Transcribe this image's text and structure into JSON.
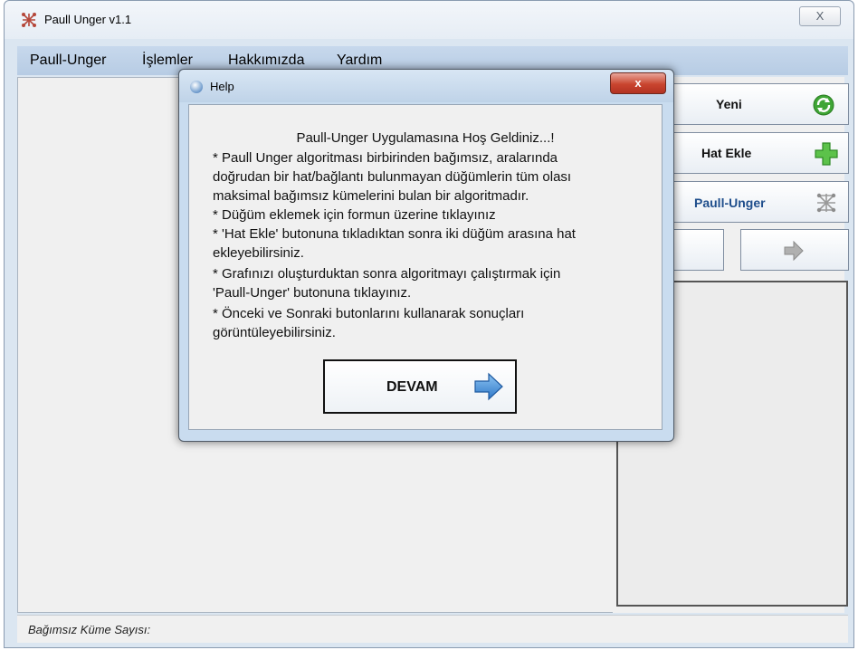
{
  "window": {
    "title": "Paull Unger v1.1",
    "close_glyph": "X",
    "app_icon": "graph-icon"
  },
  "menu": {
    "items": [
      "Paull-Unger",
      "İşlemler",
      "Hakkımızda",
      "Yardım"
    ]
  },
  "toolbar": {
    "new_label": "Yeni",
    "new_icon": "refresh-green-icon",
    "add_edge_label": "Hat Ekle",
    "add_edge_icon": "plus-green-icon",
    "run_label": "Paull-Unger",
    "run_icon": "graph-icon",
    "prev_icon": "arrow-left-gray-icon",
    "next_icon": "arrow-right-gray-icon"
  },
  "status": {
    "label": "Bağımsız Küme Sayısı:"
  },
  "dialog": {
    "title": "Help",
    "close_glyph": "x",
    "welcome": "Paull-Unger Uygulamasına Hoş Geldiniz...!",
    "lines": [
      "* Paull Unger algoritması birbirinden bağımsız, aralarında",
      "doğrudan bir hat/bağlantı bulunmayan düğümlerin tüm olası",
      "maksimal bağımsız kümelerini bulan bir algoritmadır.",
      "* Düğüm eklemek için formun üzerine tıklayınız",
      "* 'Hat Ekle' butonuna tıkladıktan sonra iki düğüm arasına hat",
      "ekleyebilirsiniz.",
      "* Grafınızı oluşturduktan sonra algoritmayı çalıştırmak için",
      "'Paull-Unger' butonuna tıklayınız.",
      "* Önceki ve Sonraki butonlarını kullanarak sonuçları",
      "görüntüleyebilirsiniz."
    ],
    "continue_label": "DEVAM",
    "continue_icon": "arrow-right-blue-icon"
  },
  "colors": {
    "menubar": "#bcd0e7",
    "dialog_close": "#c9452f",
    "green_icon": "#3fa535",
    "blue_arrow": "#3a86d6",
    "run_label": "#1f4e8c"
  }
}
